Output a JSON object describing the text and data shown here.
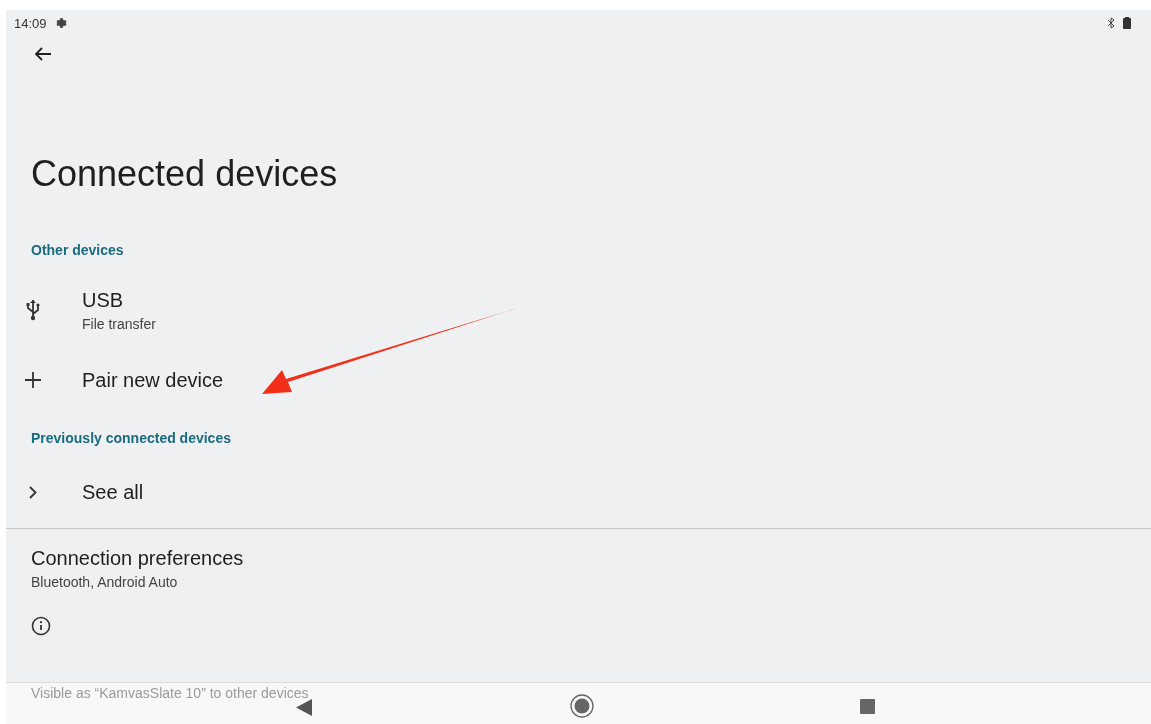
{
  "status_bar": {
    "time": "14:09"
  },
  "title": "Connected devices",
  "sections": [
    {
      "header": "Other devices",
      "items": [
        {
          "kind": "usb",
          "title": "USB",
          "subtitle": "File transfer"
        },
        {
          "kind": "add",
          "title": "Pair new device"
        }
      ]
    },
    {
      "header": "Previously connected devices",
      "items": [
        {
          "kind": "chevron",
          "title": "See all"
        }
      ]
    }
  ],
  "preferences": {
    "title": "Connection preferences",
    "subtitle": "Bluetooth, Android Auto"
  },
  "footer_text": "Visible as “KamvasSlate 10” to other devices"
}
